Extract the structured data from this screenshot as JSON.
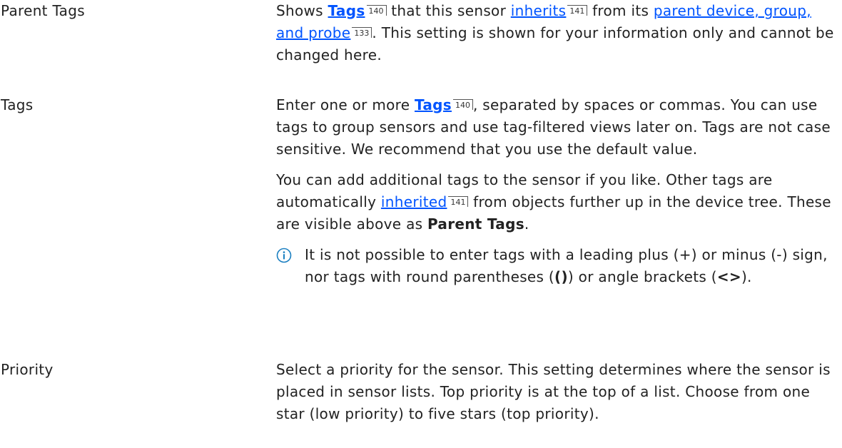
{
  "parent_tags": {
    "label": "Parent Tags",
    "t1": "Shows ",
    "link1": "Tags",
    "ref1": "140",
    "t2": " that this sensor ",
    "link2": "inherits",
    "ref2": "141",
    "t3": " from its ",
    "link3": "parent device, group, and probe",
    "ref3": "133",
    "t4": ". This setting is shown for your information only and cannot be changed here."
  },
  "tags": {
    "label": "Tags",
    "p1_t1": "Enter one or more ",
    "p1_link": "Tags",
    "p1_ref": "140",
    "p1_t2": ", separated by spaces or commas. You can use tags to group sensors and use tag-filtered views later on. Tags are not case sensitive. We recommend that you use the default value.",
    "p2_t1": "You can add additional tags to the sensor if you like. Other tags are automatically ",
    "p2_link": "inherited",
    "p2_ref": "141",
    "p2_t2": " from objects further up in the device tree. These are visible above as ",
    "p2_bold": "Parent Tags",
    "p2_t3": ".",
    "note_icon": "info-icon",
    "note_t1": "It is not possible to enter tags with a leading plus (+) or minus (-) sign, nor tags with round parentheses (",
    "note_b1": "()",
    "note_t2": ") or angle brackets (",
    "note_b2": "<>",
    "note_t3": ")."
  },
  "priority": {
    "label": "Priority",
    "text": "Select a priority for the sensor. This setting determines where the sensor is placed in sensor lists. Top priority is at the top of a list. Choose from one star (low priority) to five stars (top priority)."
  },
  "colors": {
    "link": "#0054ff",
    "text": "#222222",
    "icon": "#1a7fc1"
  }
}
